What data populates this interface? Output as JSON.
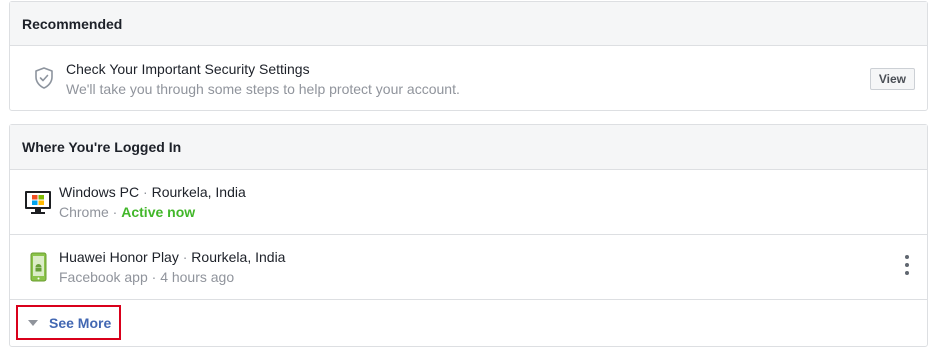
{
  "recommended": {
    "header": "Recommended",
    "item": {
      "title": "Check Your Important Security Settings",
      "subtitle": "We'll take you through some steps to help protect your account.",
      "button_label": "View",
      "icon": "shield-check-icon"
    }
  },
  "logged_in": {
    "header": "Where You're Logged In",
    "devices": [
      {
        "name": "Windows PC",
        "separator": " · ",
        "location": "Rourkela, India",
        "app": "Chrome",
        "status": "Active now",
        "icon": "desktop-windows-icon"
      },
      {
        "name": "Huawei Honor Play",
        "separator": " · ",
        "location": "Rourkela, India",
        "app": "Facebook app",
        "status": "4 hours ago",
        "icon": "android-phone-icon"
      }
    ],
    "see_more_label": "See More"
  },
  "colors": {
    "active": "#42b72a",
    "link": "#4267b2",
    "highlight_border": "#d9001b",
    "secondary_text": "#90949c"
  }
}
